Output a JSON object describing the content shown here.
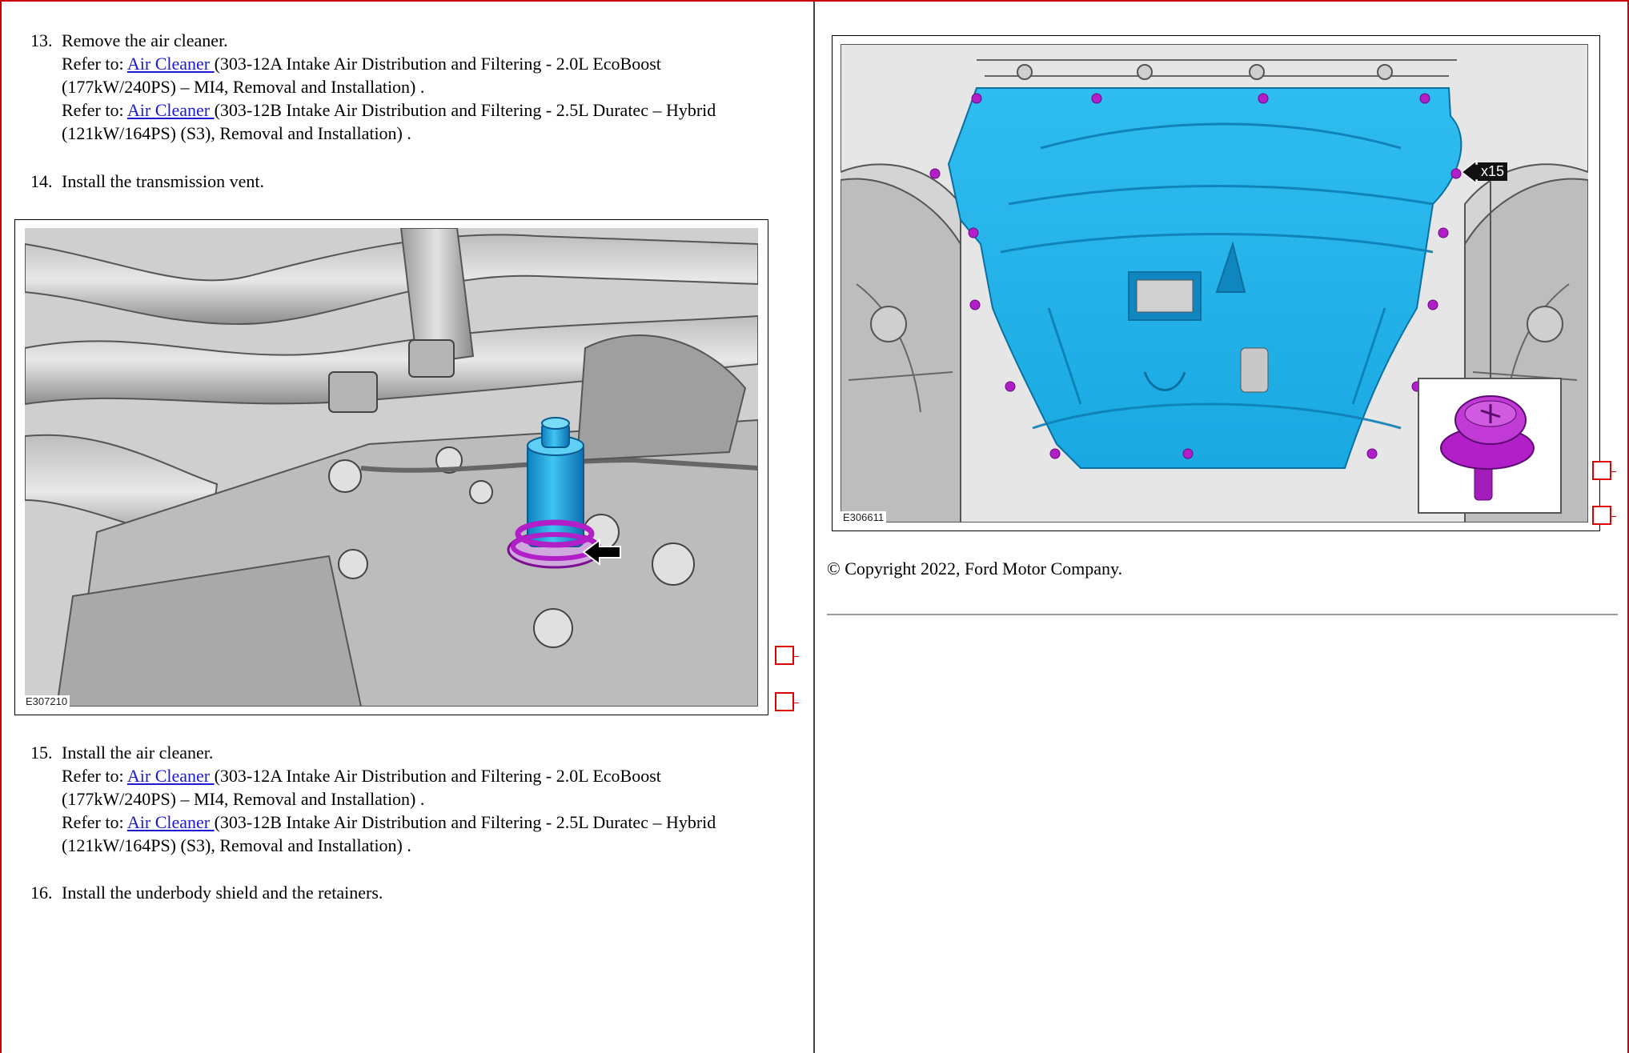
{
  "steps": {
    "s13": {
      "number": "13.",
      "title": "Remove the air cleaner.",
      "ref1": {
        "prefix": "Refer to: ",
        "link": "Air Cleaner ",
        "text1": "(303-12A Intake Air Distribution and Filtering - 2.0L EcoBoost",
        "text2": "(177kW/240PS) – MI4, Removal and Installation) ."
      },
      "ref2": {
        "prefix": "Refer to: ",
        "link": "Air Cleaner ",
        "text1": "(303-12B Intake Air Distribution and Filtering - 2.5L Duratec – Hybrid",
        "text2": "(121kW/164PS) (S3), Removal and Installation) ."
      }
    },
    "s14": {
      "number": "14.",
      "title": "Install the transmission vent."
    },
    "s15": {
      "number": "15.",
      "title": "Install the air cleaner.",
      "ref1": {
        "prefix": "Refer to: ",
        "link": "Air Cleaner ",
        "text1": "(303-12A Intake Air Distribution and Filtering - 2.0L EcoBoost",
        "text2": "(177kW/240PS) – MI4, Removal and Installation) ."
      },
      "ref2": {
        "prefix": "Refer to: ",
        "link": "Air Cleaner ",
        "text1": "(303-12B Intake Air Distribution and Filtering - 2.5L Duratec – Hybrid",
        "text2": "(121kW/164PS) (S3), Removal and Installation) ."
      }
    },
    "s16": {
      "number": "16.",
      "title": "Install the underbody shield and the retainers."
    }
  },
  "figures": {
    "transmission_vent": {
      "label": "E307210"
    },
    "underbody_shield": {
      "label": "E306611",
      "callout": "x15"
    }
  },
  "copyright": "© Copyright 2022, Ford Motor Company.",
  "colors": {
    "link": "#1a1ad4",
    "highlight_blue": "#19aee8",
    "highlight_magenta": "#b21ec8",
    "checkbox": "#dd0000"
  }
}
